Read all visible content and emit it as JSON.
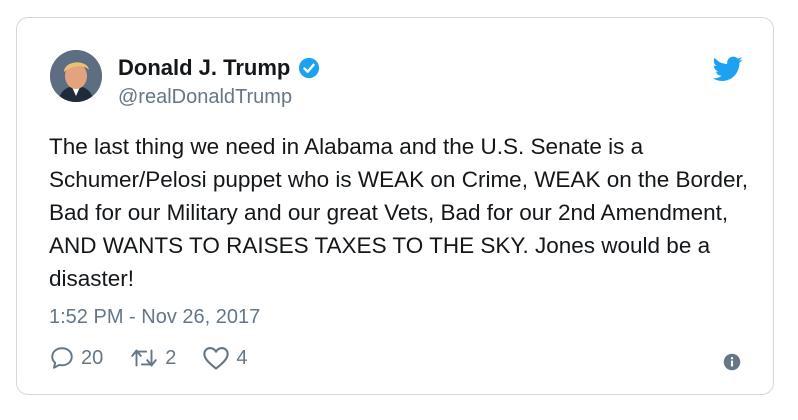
{
  "author": {
    "name": "Donald J. Trump",
    "handle": "@realDonaldTrump",
    "verified": true
  },
  "tweet": {
    "text": "The last thing we need in Alabama and the U.S. Senate is a Schumer/Pelosi puppet who is WEAK on Crime, WEAK on the Border, Bad for our Military and our great Vets, Bad for our 2nd Amendment, AND WANTS TO RAISES TAXES TO THE SKY. Jones would be a disaster!",
    "timestamp": "1:52 PM - Nov 26, 2017"
  },
  "actions": {
    "replies": "20",
    "retweets": "2",
    "likes": "4"
  },
  "icons": {
    "brand": "twitter-bird-icon",
    "verified": "verified-badge-icon",
    "reply": "reply-icon",
    "retweet": "retweet-icon",
    "like": "heart-icon",
    "info": "info-icon"
  },
  "colors": {
    "twitter_blue": "#1da1f2",
    "text": "#14171a",
    "secondary": "#657786",
    "border": "#cfd9de"
  }
}
